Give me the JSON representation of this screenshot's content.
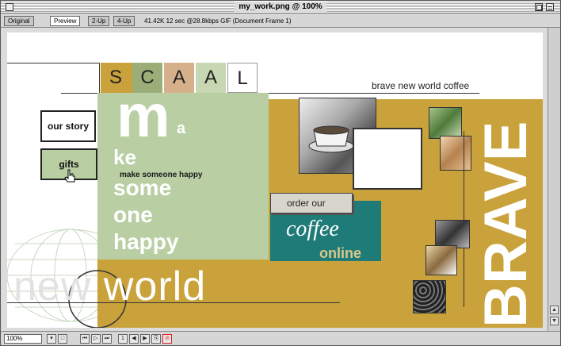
{
  "window": {
    "title": "my_work.png @ 100%"
  },
  "tabs": [
    {
      "label": "Original"
    },
    {
      "label": "Preview"
    },
    {
      "label": "2-Up"
    },
    {
      "label": "4-Up"
    }
  ],
  "info": "41.42K  12 sec @28.8kbps  GIF (Document Frame 1)",
  "page": {
    "logo_letters": [
      "S",
      "C",
      "A",
      "A",
      "L"
    ],
    "tagline": "brave new world coffee",
    "nav": {
      "our_story": "our story",
      "gifts": "gifts"
    },
    "hero": {
      "big_m": "m",
      "small_a": "a",
      "ke": "ke",
      "make_someone_happy": "make someone happy",
      "some": "some",
      "one": "one",
      "happy": "happy"
    },
    "order_button": "order our",
    "coffee": "coffee",
    "online": "online",
    "new": "new",
    "world": "world",
    "brave": "BRAVE"
  },
  "status": {
    "zoom": "100%"
  },
  "colors": {
    "gold": "#c9a23b",
    "sage": "#b9cfa3",
    "teal": "#1f7b78"
  }
}
